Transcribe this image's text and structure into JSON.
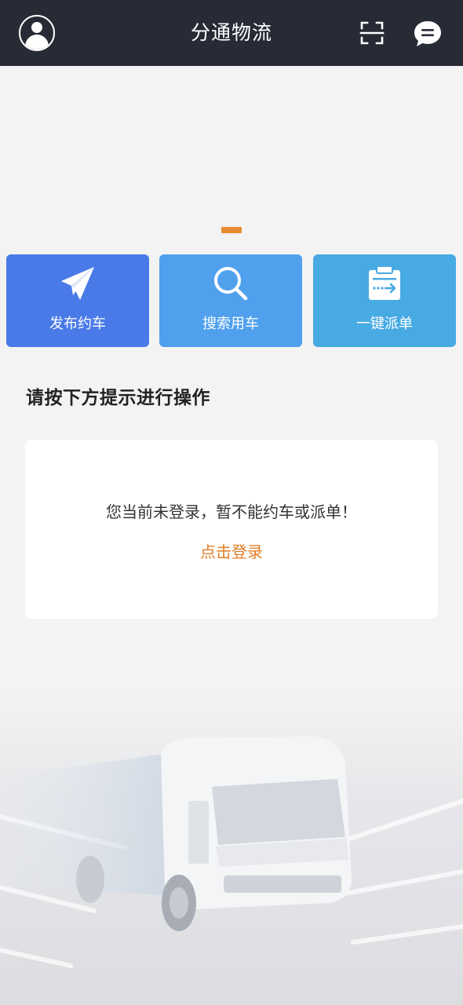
{
  "header": {
    "title": "分通物流",
    "icons": {
      "profile": "user-avatar-icon",
      "scan": "scan-icon",
      "messages": "chat-bubble-icon"
    }
  },
  "actions": [
    {
      "label": "发布约车",
      "icon": "paper-plane-icon",
      "color": "#4a7ae8"
    },
    {
      "label": "搜索用车",
      "icon": "search-icon",
      "color": "#50a0ee"
    },
    {
      "label": "一键派单",
      "icon": "clipboard-arrow-icon",
      "color": "#48aae3"
    }
  ],
  "section": {
    "title": "请按下方提示进行操作"
  },
  "notice": {
    "message": "您当前未登录，暂不能约车或派单！",
    "login_link": "点击登录"
  },
  "colors": {
    "header_bg": "#262b35",
    "accent": "#e07d24",
    "page_bg": "#f3f3f3"
  }
}
